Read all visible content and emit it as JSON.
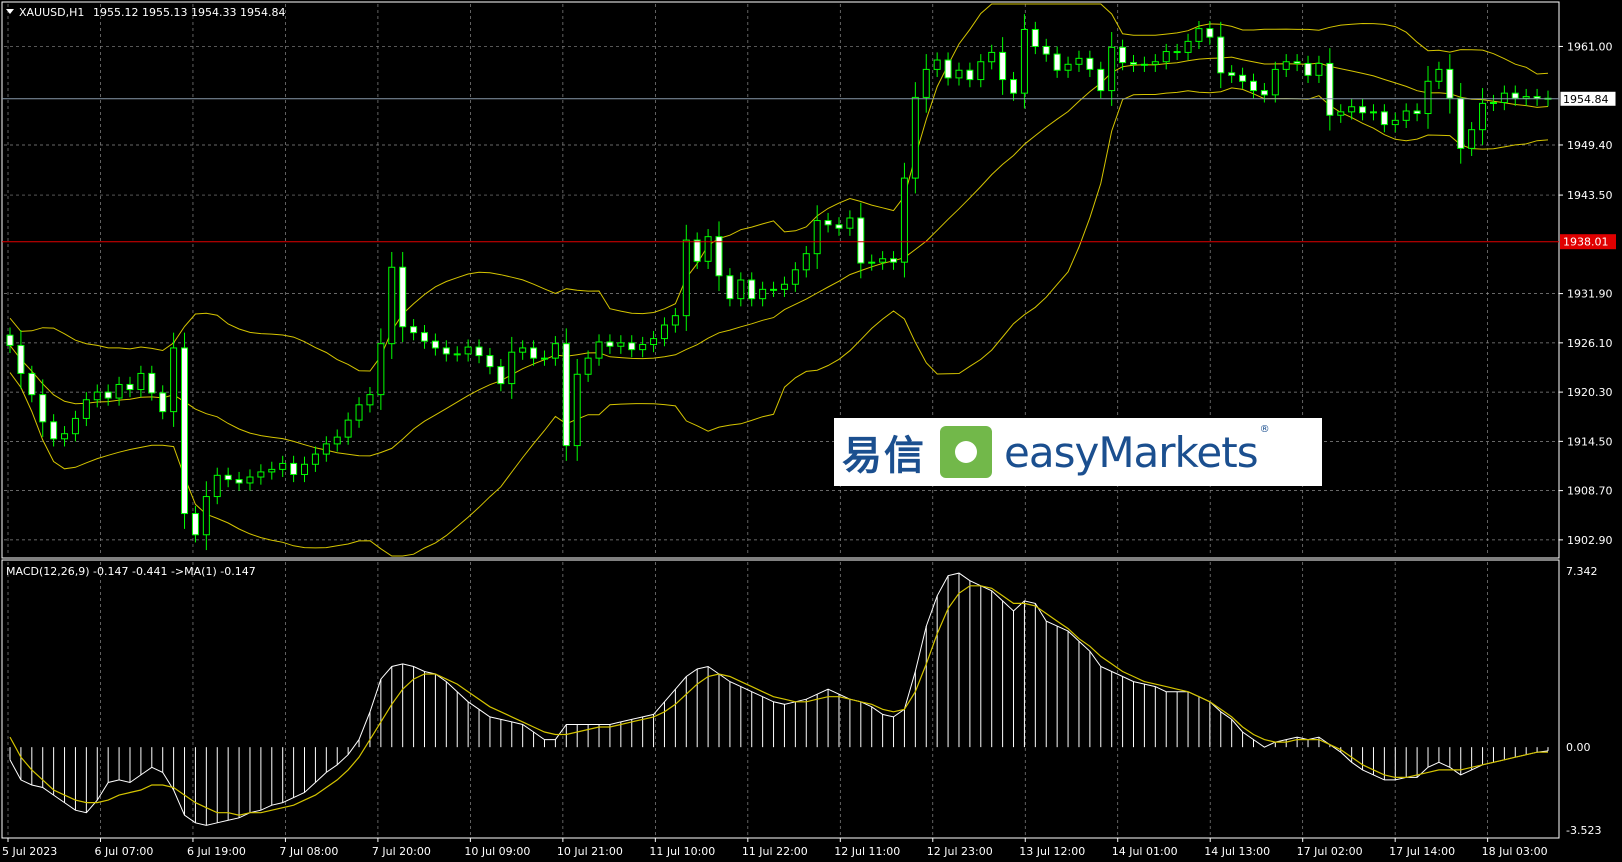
{
  "header": {
    "symbol": "XAUUSD,H1",
    "ohlc": "1955.12 1955.13 1954.33 1954.84"
  },
  "macd_header": "MACD(12,26,9) -0.147 -0.441  ->MA(1) -0.147",
  "price_axis": [
    "1961.00",
    "1949.40",
    "1943.50",
    "1931.90",
    "1926.10",
    "1920.30",
    "1914.50",
    "1908.70",
    "1902.90"
  ],
  "current_price_label": "1954.84",
  "level_label": "1938.01",
  "macd_axis": {
    "top": "7.342",
    "zero": "0.00",
    "bottom": "-3.523"
  },
  "time_axis": [
    "5 Jul 2023",
    "6 Jul 07:00",
    "6 Jul 19:00",
    "7 Jul 08:00",
    "7 Jul 20:00",
    "10 Jul 09:00",
    "10 Jul 21:00",
    "11 Jul 10:00",
    "11 Jul 22:00",
    "12 Jul 11:00",
    "12 Jul 23:00",
    "13 Jul 12:00",
    "14 Jul 01:00",
    "14 Jul 13:00",
    "17 Jul 02:00",
    "17 Jul 14:00",
    "18 Jul 03:00"
  ],
  "watermark": {
    "cn": "易信",
    "en": "easyMarkets",
    "reg": "®"
  },
  "colors": {
    "background": "#000000",
    "grid": "#8a8a8a",
    "bull_candle": "#00ff00",
    "bear_candle_body": "#ffffff",
    "bollinger": "#d4c400",
    "level_line": "#e00000",
    "current_line": "#8899aa",
    "macd_hist": "#ffffff",
    "macd_signal": "#d4c400"
  },
  "chart_data": {
    "type": "candlestick",
    "timeframe": "H1",
    "ylim": [
      1901.0,
      1966.0
    ],
    "horizontal_levels": [
      1954.84,
      1938.01
    ],
    "closes": [
      1925.8,
      1922.5,
      1920.0,
      1916.8,
      1914.8,
      1915.4,
      1917.2,
      1919.4,
      1920.3,
      1919.6,
      1921.2,
      1920.6,
      1922.5,
      1920.2,
      1918.0,
      1925.5,
      1906.0,
      1903.5,
      1908.0,
      1910.5,
      1910.0,
      1909.6,
      1910.3,
      1910.9,
      1911.2,
      1911.9,
      1910.6,
      1911.8,
      1913.0,
      1914.2,
      1915.0,
      1917.0,
      1918.8,
      1920.0,
      1926.0,
      1935.0,
      1928.0,
      1927.3,
      1926.3,
      1925.5,
      1924.8,
      1924.8,
      1925.6,
      1924.6,
      1923.3,
      1921.3,
      1925.0,
      1925.5,
      1924.3,
      1924.3,
      1926.0,
      1914.0,
      1922.4,
      1924.3,
      1926.2,
      1925.7,
      1926.1,
      1925.3,
      1925.9,
      1926.6,
      1928.2,
      1929.3,
      1938.2,
      1935.7,
      1938.6,
      1934.0,
      1931.3,
      1933.5,
      1931.3,
      1932.4,
      1932.4,
      1933.0,
      1934.7,
      1936.6,
      1940.5,
      1940.0,
      1939.6,
      1940.8,
      1935.5,
      1935.6,
      1936.0,
      1935.6,
      1945.5,
      1955.0,
      1958.3,
      1959.4,
      1957.3,
      1958.2,
      1957.1,
      1959.2,
      1960.3,
      1957.1,
      1955.5,
      1963.0,
      1961.0,
      1960.1,
      1958.2,
      1958.9,
      1959.6,
      1958.3,
      1955.8,
      1960.9,
      1959.1,
      1958.9,
      1958.9,
      1959.2,
      1960.4,
      1960.3,
      1961.6,
      1963.1,
      1962.1,
      1957.9,
      1957.6,
      1956.9,
      1955.8,
      1955.3,
      1958.3,
      1959.2,
      1959.0,
      1957.6,
      1959.0,
      1952.9,
      1953.3,
      1953.9,
      1953.2,
      1953.3,
      1951.8,
      1952.3,
      1953.4,
      1953.1,
      1956.9,
      1958.3,
      1954.9,
      1949.0,
      1951.2,
      1954.3,
      1954.4,
      1955.5,
      1954.9,
      1955.1,
      1954.9,
      1954.84
    ],
    "macd_ylim": [
      -3.523,
      7.342
    ],
    "macd_hist": [
      -0.5,
      -1.3,
      -1.5,
      -1.6,
      -1.9,
      -2.2,
      -2.5,
      -2.6,
      -2.1,
      -1.4,
      -1.3,
      -1.4,
      -1.1,
      -0.8,
      -1.0,
      -1.7,
      -2.7,
      -3.0,
      -3.1,
      -3.0,
      -2.9,
      -2.8,
      -2.6,
      -2.5,
      -2.3,
      -2.2,
      -2.0,
      -1.8,
      -1.4,
      -1.0,
      -0.7,
      -0.3,
      0.3,
      1.4,
      2.7,
      3.2,
      3.3,
      3.2,
      3.0,
      2.9,
      2.6,
      2.2,
      1.8,
      1.5,
      1.2,
      1.1,
      1.0,
      0.9,
      0.6,
      0.3,
      0.3,
      0.9,
      0.9,
      0.9,
      0.9,
      0.9,
      1.0,
      1.1,
      1.2,
      1.3,
      1.8,
      2.3,
      2.8,
      3.1,
      3.2,
      2.9,
      2.6,
      2.4,
      2.2,
      2.0,
      1.8,
      1.7,
      1.8,
      1.9,
      2.1,
      2.3,
      2.1,
      1.9,
      1.8,
      1.6,
      1.3,
      1.2,
      1.5,
      3.0,
      4.8,
      6.0,
      6.8,
      6.9,
      6.6,
      6.4,
      6.2,
      5.8,
      5.4,
      5.8,
      5.7,
      5.0,
      4.8,
      4.6,
      4.2,
      3.8,
      3.2,
      3.0,
      2.8,
      2.6,
      2.5,
      2.4,
      2.2,
      2.2,
      2.2,
      2.0,
      1.8,
      1.4,
      1.1,
      0.6,
      0.3,
      0.0,
      0.2,
      0.3,
      0.4,
      0.3,
      0.4,
      0.1,
      -0.2,
      -0.6,
      -0.9,
      -1.1,
      -1.3,
      -1.3,
      -1.2,
      -1.2,
      -0.8,
      -0.6,
      -0.8,
      -1.1,
      -0.9,
      -0.7,
      -0.6,
      -0.5,
      -0.4,
      -0.3,
      -0.2,
      -0.147
    ],
    "macd_signal": [
      0.4,
      -0.4,
      -0.9,
      -1.3,
      -1.7,
      -1.9,
      -2.1,
      -2.2,
      -2.2,
      -2.1,
      -1.9,
      -1.8,
      -1.7,
      -1.5,
      -1.5,
      -1.6,
      -1.9,
      -2.2,
      -2.4,
      -2.6,
      -2.6,
      -2.7,
      -2.6,
      -2.6,
      -2.5,
      -2.4,
      -2.3,
      -2.1,
      -1.9,
      -1.6,
      -1.3,
      -0.9,
      -0.4,
      0.3,
      1.0,
      1.7,
      2.3,
      2.7,
      2.9,
      2.9,
      2.7,
      2.5,
      2.2,
      1.9,
      1.6,
      1.4,
      1.2,
      1.0,
      0.8,
      0.6,
      0.5,
      0.5,
      0.6,
      0.7,
      0.8,
      0.8,
      0.9,
      1.0,
      1.1,
      1.2,
      1.4,
      1.7,
      2.1,
      2.5,
      2.8,
      2.9,
      2.8,
      2.6,
      2.4,
      2.2,
      2.0,
      1.9,
      1.8,
      1.8,
      1.9,
      2.0,
      2.0,
      1.9,
      1.8,
      1.7,
      1.5,
      1.4,
      1.5,
      2.2,
      3.3,
      4.5,
      5.5,
      6.1,
      6.4,
      6.4,
      6.3,
      6.0,
      5.7,
      5.7,
      5.6,
      5.3,
      5.0,
      4.7,
      4.3,
      4.0,
      3.6,
      3.3,
      3.0,
      2.8,
      2.6,
      2.5,
      2.4,
      2.3,
      2.2,
      2.0,
      1.8,
      1.5,
      1.2,
      0.8,
      0.5,
      0.3,
      0.2,
      0.2,
      0.3,
      0.3,
      0.3,
      0.1,
      -0.1,
      -0.4,
      -0.7,
      -0.9,
      -1.1,
      -1.2,
      -1.2,
      -1.1,
      -1.0,
      -0.9,
      -0.9,
      -0.9,
      -0.8,
      -0.7,
      -0.6,
      -0.5,
      -0.4,
      -0.3,
      -0.2,
      -0.2
    ]
  }
}
